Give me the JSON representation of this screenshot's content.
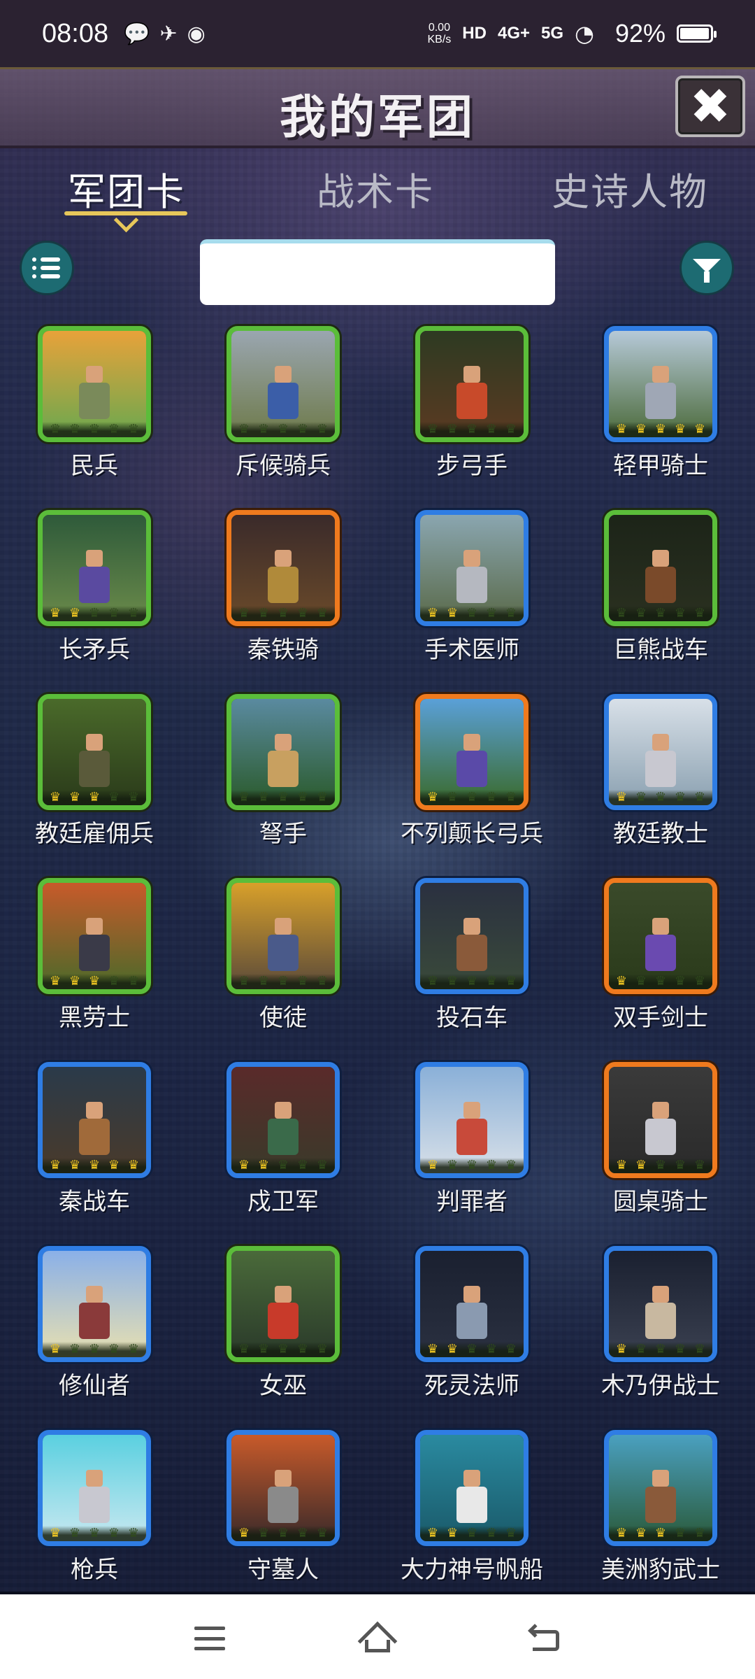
{
  "status_bar": {
    "time": "08:08",
    "icons": [
      "wechat-icon",
      "send-icon",
      "weibo-icon"
    ],
    "net_speed_value": "0.00",
    "net_speed_unit": "KB/s",
    "hd_label": "HD",
    "signal_4g": "4G+",
    "signal_5g": "5G",
    "battery": "92%"
  },
  "header": {
    "title": "我的军团",
    "close_label": "✖"
  },
  "tabs": [
    {
      "label": "军团卡",
      "active": true
    },
    {
      "label": "战术卡",
      "active": false
    },
    {
      "label": "史诗人物",
      "active": false
    }
  ],
  "search": {
    "value": "",
    "placeholder": ""
  },
  "units": [
    {
      "name": "民兵",
      "rarity": "green",
      "crowns": 0,
      "scene": [
        "#e8a23a",
        "#6aa84f"
      ],
      "body": "#7a8a5a"
    },
    {
      "name": "斥候骑兵",
      "rarity": "green",
      "crowns": 0,
      "scene": [
        "#9aa6b0",
        "#6e7a4a"
      ],
      "body": "#3b5ea8"
    },
    {
      "name": "步弓手",
      "rarity": "green",
      "crowns": 0,
      "scene": [
        "#2d3a22",
        "#5b3a22"
      ],
      "body": "#c84a2a"
    },
    {
      "name": "轻甲骑士",
      "rarity": "blue",
      "crowns": 5,
      "scene": [
        "#b6c9d8",
        "#4b6a3a"
      ],
      "body": "#9fa7b5"
    },
    {
      "name": "长矛兵",
      "rarity": "green",
      "crowns": 2,
      "scene": [
        "#2e5a3a",
        "#6a8a4a"
      ],
      "body": "#5a4aa0"
    },
    {
      "name": "秦铁骑",
      "rarity": "orange",
      "crowns": 0,
      "scene": [
        "#3a2a2a",
        "#6a4a2a"
      ],
      "body": "#b08a3a"
    },
    {
      "name": "手术医师",
      "rarity": "blue",
      "crowns": 2,
      "scene": [
        "#8aa6b0",
        "#5a6a4a"
      ],
      "body": "#b5b8c0"
    },
    {
      "name": "巨熊战车",
      "rarity": "green",
      "crowns": 0,
      "scene": [
        "#1c2418",
        "#2a3020"
      ],
      "body": "#7a4a2a"
    },
    {
      "name": "教廷雇佣兵",
      "rarity": "green",
      "crowns": 3,
      "scene": [
        "#4a6a2a",
        "#2a3a1a"
      ],
      "body": "#5a5a3a"
    },
    {
      "name": "弩手",
      "rarity": "green",
      "crowns": 0,
      "scene": [
        "#5a8aa0",
        "#2a5a2a"
      ],
      "body": "#c8a060"
    },
    {
      "name": "不列颠长弓兵",
      "rarity": "orange",
      "crowns": 1,
      "scene": [
        "#5aa0d8",
        "#3a6a2a"
      ],
      "body": "#5a4aa8"
    },
    {
      "name": "教廷教士",
      "rarity": "blue",
      "crowns": 1,
      "scene": [
        "#d8e0e8",
        "#8aa0b0"
      ],
      "body": "#c8c8d0"
    },
    {
      "name": "黑劳士",
      "rarity": "green",
      "crowns": 3,
      "scene": [
        "#c85a2a",
        "#4a6a2a"
      ],
      "body": "#3a3a48"
    },
    {
      "name": "使徒",
      "rarity": "green",
      "crowns": 0,
      "scene": [
        "#d8a02a",
        "#5a4a3a"
      ],
      "body": "#4a5a8a"
    },
    {
      "name": "投石车",
      "rarity": "blue",
      "crowns": 0,
      "scene": [
        "#2a3040",
        "#3a4a3a"
      ],
      "body": "#8a5a3a"
    },
    {
      "name": "双手剑士",
      "rarity": "orange",
      "crowns": 1,
      "scene": [
        "#3a4a2a",
        "#2a3a1a"
      ],
      "body": "#6a4ab0"
    },
    {
      "name": "秦战车",
      "rarity": "blue",
      "crowns": 5,
      "scene": [
        "#2a3a4a",
        "#4a3a2a"
      ],
      "body": "#a06a3a"
    },
    {
      "name": "戍卫军",
      "rarity": "blue",
      "crowns": 2,
      "scene": [
        "#5a2a2a",
        "#3a3a2a"
      ],
      "body": "#3a6a4a"
    },
    {
      "name": "判罪者",
      "rarity": "blue",
      "crowns": 1,
      "scene": [
        "#8ab0d8",
        "#d8e0e8"
      ],
      "body": "#c84a3a"
    },
    {
      "name": "圆桌骑士",
      "rarity": "orange",
      "crowns": 2,
      "scene": [
        "#3a3a3a",
        "#2a2a2a"
      ],
      "body": "#c8c8d0"
    },
    {
      "name": "修仙者",
      "rarity": "blue",
      "crowns": 1,
      "scene": [
        "#8ab0e8",
        "#e8e0b0"
      ],
      "body": "#8a3a3a"
    },
    {
      "name": "女巫",
      "rarity": "green",
      "crowns": 0,
      "scene": [
        "#4a6a3a",
        "#2a3a2a"
      ],
      "body": "#c83a2a"
    },
    {
      "name": "死灵法师",
      "rarity": "blue",
      "crowns": 2,
      "scene": [
        "#1a2030",
        "#2a3040"
      ],
      "body": "#8a9ab0"
    },
    {
      "name": "木乃伊战士",
      "rarity": "blue",
      "crowns": 1,
      "scene": [
        "#1a2030",
        "#3a4050"
      ],
      "body": "#c8b8a0"
    },
    {
      "name": "枪兵",
      "rarity": "blue",
      "crowns": 1,
      "scene": [
        "#5ad0e0",
        "#c8e8f0"
      ],
      "body": "#c8c8d0"
    },
    {
      "name": "守墓人",
      "rarity": "blue",
      "crowns": 1,
      "scene": [
        "#c85a2a",
        "#3a2a2a"
      ],
      "body": "#8a8a8a"
    },
    {
      "name": "大力神号帆船",
      "rarity": "blue",
      "crowns": 2,
      "scene": [
        "#2a8aa0",
        "#1a5a6a"
      ],
      "body": "#e8e8e8"
    },
    {
      "name": "美洲豹武士",
      "rarity": "blue",
      "crowns": 3,
      "scene": [
        "#4aa0c0",
        "#2a5a3a"
      ],
      "body": "#8a5a3a"
    }
  ],
  "nav": [
    "menu-icon",
    "home-icon",
    "back-icon"
  ]
}
